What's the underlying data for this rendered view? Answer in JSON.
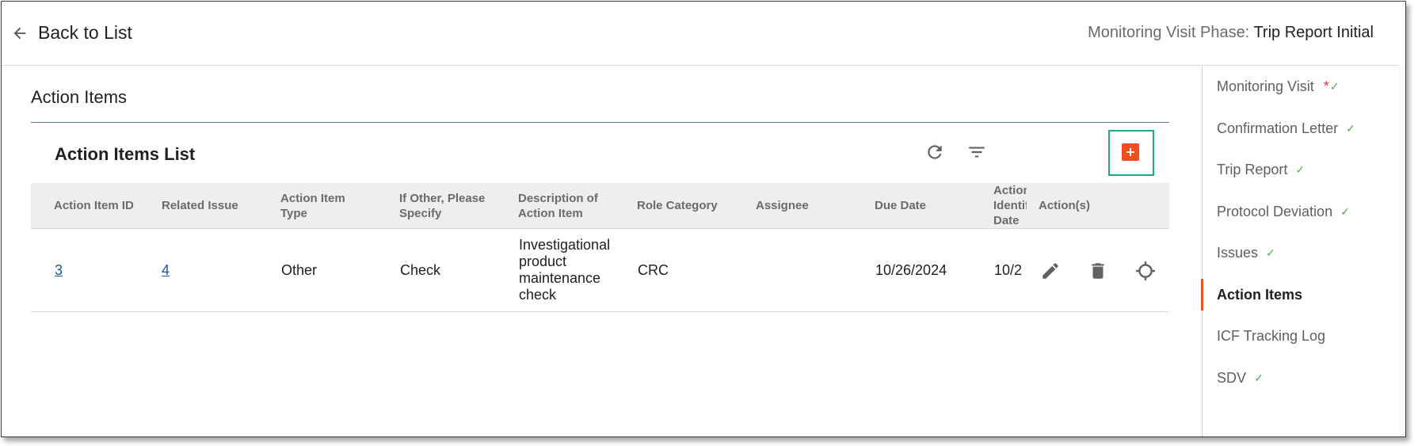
{
  "header": {
    "back_label": "Back to List",
    "phase_label": "Monitoring Visit Phase:",
    "phase_value": "Trip Report Initial"
  },
  "section": {
    "title": "Action Items"
  },
  "list": {
    "title": "Action Items List",
    "columns": [
      "Action Item ID",
      "Related Issue",
      "Action Item Type",
      "If Other, Please Specify",
      "Description of Action Item",
      "Role Category",
      "Assignee",
      "Due Date",
      "Action Identified Date",
      "Action(s)"
    ],
    "rows": [
      {
        "id": "3",
        "related_issue": "4",
        "type": "Other",
        "if_other": "Check",
        "description": "Investigational product maintenance check",
        "role_category": "CRC",
        "assignee": "",
        "due_date": "10/26/2024",
        "identified_date": "10/2"
      }
    ]
  },
  "sidebar": {
    "items": [
      {
        "label": "Monitoring Visit",
        "required": "*",
        "complete": true,
        "active": false
      },
      {
        "label": "Confirmation Letter",
        "complete": true,
        "active": false
      },
      {
        "label": "Trip Report",
        "complete": true,
        "active": false
      },
      {
        "label": "Protocol Deviation",
        "complete": true,
        "active": false
      },
      {
        "label": "Issues",
        "complete": true,
        "active": false
      },
      {
        "label": "Action Items",
        "complete": false,
        "active": true
      },
      {
        "label": "ICF Tracking Log",
        "complete": false,
        "active": false
      },
      {
        "label": "SDV",
        "complete": true,
        "active": false
      }
    ],
    "check_glyph": "✓"
  },
  "icons": {
    "back": "arrow-left-icon",
    "refresh": "refresh-icon",
    "filter": "filter-icon",
    "add": "plus-box-icon",
    "edit": "pencil-icon",
    "delete": "trash-icon",
    "target": "crosshair-icon"
  },
  "colors": {
    "accent": "#f04e1f",
    "highlight": "#1aa886",
    "link": "#1a56a8",
    "check": "#4caf50"
  }
}
